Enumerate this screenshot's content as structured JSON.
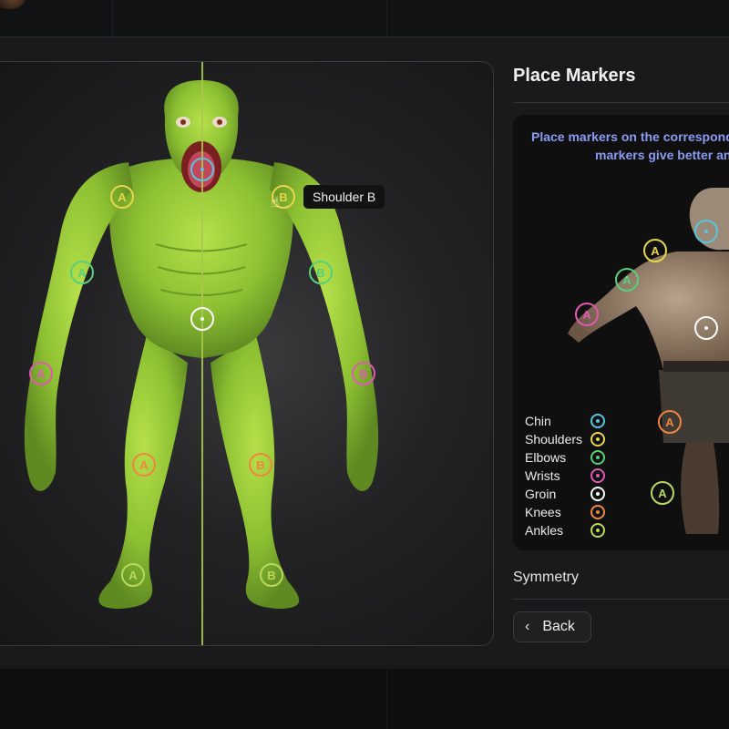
{
  "panel": {
    "title": "Place Markers",
    "instructions_line1": "Place markers on the correspondin",
    "instructions_line2": "markers give better ani",
    "symmetry_label": "Symmetry",
    "back_label": "Back"
  },
  "tooltip": "Shoulder B",
  "legend": [
    {
      "label": "Chin",
      "color": "#56c6e0"
    },
    {
      "label": "Shoulders",
      "color": "#e7d64a"
    },
    {
      "label": "Elbows",
      "color": "#57d07a"
    },
    {
      "label": "Wrists",
      "color": "#e05ab2"
    },
    {
      "label": "Groin",
      "color": "#ffffff"
    },
    {
      "label": "Knees",
      "color": "#ee8642"
    },
    {
      "label": "Ankles",
      "color": "#b8d95a"
    }
  ],
  "markers": {
    "chin": "",
    "shoulder_a": "A",
    "shoulder_b": "B",
    "elbow_a": "A",
    "elbow_b": "B",
    "groin": "",
    "wrist_a": "A",
    "wrist_b": "B",
    "knee_a": "A",
    "knee_b": "B",
    "ankle_a": "A",
    "ankle_b": "B"
  },
  "reference_markers": {
    "shoulder_a": "A",
    "elbow_a": "A",
    "wrist_a": "A",
    "knee_a": "A",
    "ankle_a": "A"
  }
}
